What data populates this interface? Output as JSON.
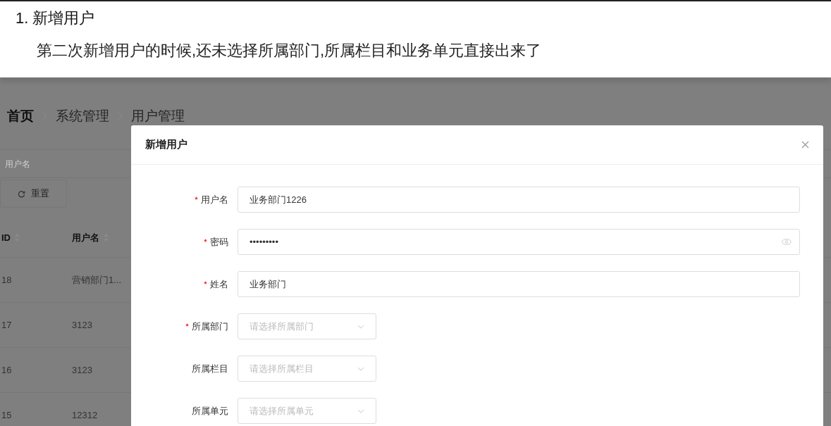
{
  "document": {
    "heading": "1. 新增用户",
    "description": "第二次新增用户的时候,还未选择所属部门,所属栏目和业务单元直接出来了"
  },
  "breadcrumb": [
    {
      "label": "首页",
      "emphasized": true
    },
    {
      "label": "系统管理",
      "emphasized": false
    },
    {
      "label": "用户管理",
      "emphasized": false
    }
  ],
  "filter": {
    "placeholder": "用户名"
  },
  "reset_button": "重置",
  "table": {
    "columns": [
      "ID",
      "用户名"
    ],
    "rows": [
      [
        "18",
        "营销部门1..."
      ],
      [
        "17",
        "3123"
      ],
      [
        "16",
        "3123"
      ],
      [
        "15",
        "12312"
      ]
    ]
  },
  "dialog": {
    "title": "新增用户",
    "fields": [
      {
        "label": "用户名",
        "required": true,
        "kind": "text",
        "value": "业务部门1226"
      },
      {
        "label": "密码",
        "required": true,
        "kind": "password",
        "value": "•••••••••"
      },
      {
        "label": "姓名",
        "required": true,
        "kind": "text",
        "value": "业务部门"
      },
      {
        "label": "所属部门",
        "required": true,
        "kind": "select",
        "placeholder": "请选择所属部门"
      },
      {
        "label": "所属栏目",
        "required": false,
        "kind": "select",
        "placeholder": "请选择所属栏目"
      },
      {
        "label": "所属单元",
        "required": false,
        "kind": "select",
        "placeholder": "请选择所属单元"
      }
    ]
  }
}
